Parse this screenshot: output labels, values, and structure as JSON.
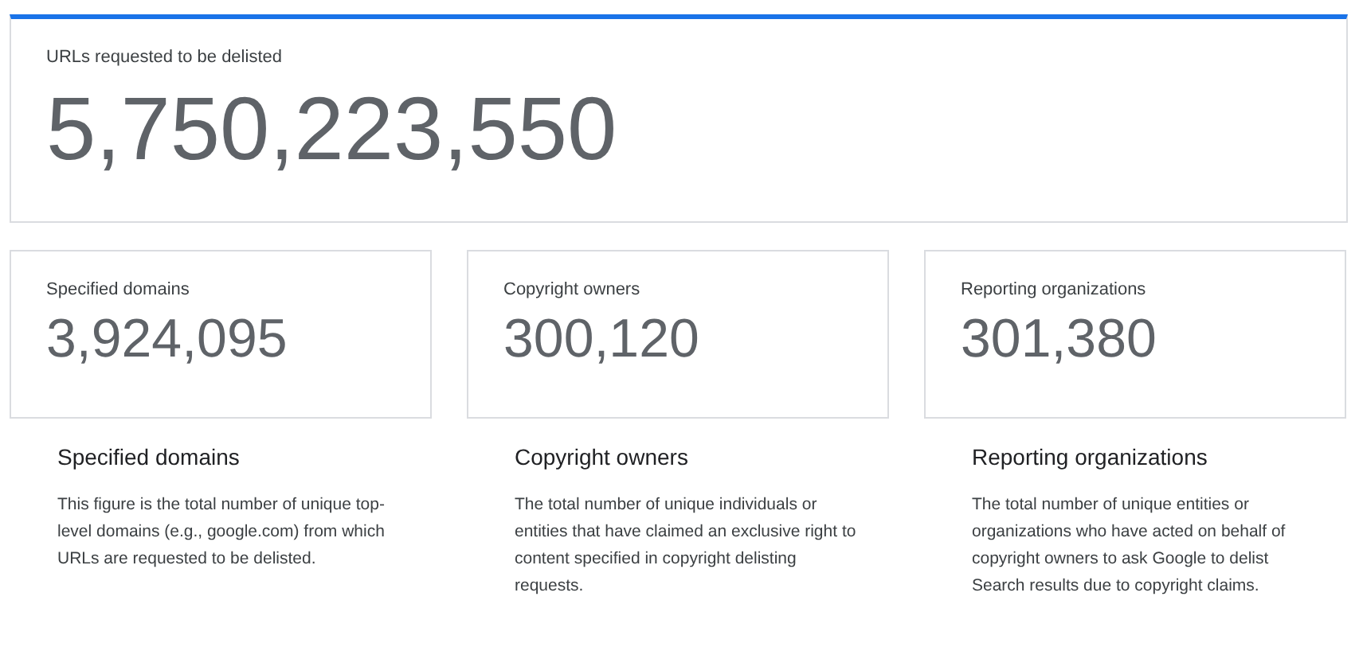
{
  "headline": {
    "label": "URLs requested to be delisted",
    "value": "5,750,223,550"
  },
  "stats": [
    {
      "label": "Specified domains",
      "value": "3,924,095"
    },
    {
      "label": "Copyright owners",
      "value": "300,120"
    },
    {
      "label": "Reporting organizations",
      "value": "301,380"
    }
  ],
  "explanations": [
    {
      "title": "Specified domains",
      "text": "This figure is the total number of unique top-level domains (e.g., google.com) from which URLs are requested to be delisted."
    },
    {
      "title": "Copyright owners",
      "text": "The total number of unique individuals or entities that have claimed an exclusive right to content specified in copyright delisting requests."
    },
    {
      "title": "Reporting organizations",
      "text": "The total number of unique entities or organizations who have acted on behalf of copyright owners to ask Google to delist Search results due to copyright claims."
    }
  ]
}
